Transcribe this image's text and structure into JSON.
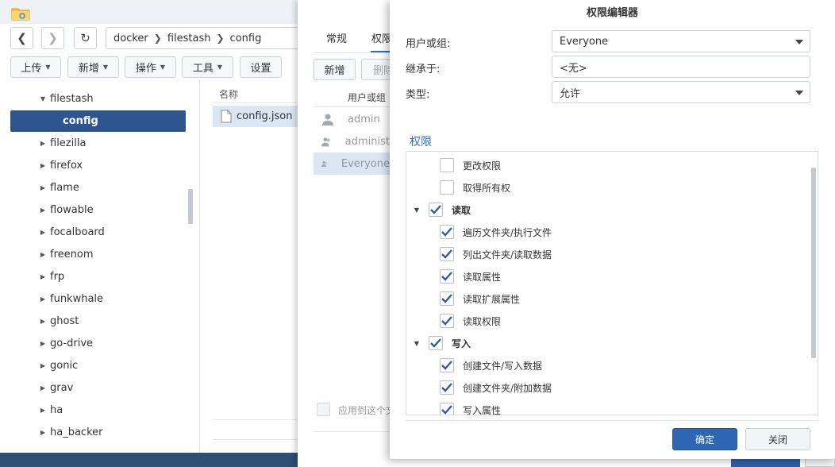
{
  "file_station": {
    "path": [
      "docker",
      "filestash",
      "config"
    ],
    "toolbar": {
      "upload": "上传",
      "create": "新增",
      "action": "操作",
      "tools": "工具",
      "settings": "设置"
    },
    "tree": {
      "parent": "filestash",
      "selected": "config",
      "items": [
        "filezilla",
        "firefox",
        "flame",
        "flowable",
        "focalboard",
        "freenom",
        "frp",
        "funkwhale",
        "ghost",
        "go-drive",
        "gonic",
        "grav",
        "ha",
        "ha_backer"
      ]
    },
    "list_header": "名称",
    "file": "config.json"
  },
  "properties": {
    "tabs": [
      "常规",
      "权限"
    ],
    "buttons": {
      "create": "新增",
      "delete": "删除"
    },
    "column_header": "用户或组",
    "rows": [
      "admin",
      "administ",
      "Everyone"
    ],
    "apply_label": "应用到这个文"
  },
  "editor": {
    "title": "权限编辑器",
    "user_label": "用户或组:",
    "user_value": "Everyone",
    "inherit_label": "继承于:",
    "inherit_value": "<无>",
    "type_label": "类型:",
    "type_value": "允许",
    "section_title": "权限",
    "perms": [
      {
        "label": "更改权限",
        "checked": false,
        "group": false
      },
      {
        "label": "取得所有权",
        "checked": false,
        "group": false
      },
      {
        "label": "读取",
        "checked": true,
        "group": true
      },
      {
        "label": "遍历文件夹/执行文件",
        "checked": true,
        "group": false
      },
      {
        "label": "列出文件夹/读取数据",
        "checked": true,
        "group": false
      },
      {
        "label": "读取属性",
        "checked": true,
        "group": false
      },
      {
        "label": "读取扩展属性",
        "checked": true,
        "group": false
      },
      {
        "label": "读取权限",
        "checked": true,
        "group": false
      },
      {
        "label": "写入",
        "checked": true,
        "group": true
      },
      {
        "label": "创建文件/写入数据",
        "checked": true,
        "group": false
      },
      {
        "label": "创建文件夹/附加数据",
        "checked": true,
        "group": false
      },
      {
        "label": "写入属性",
        "checked": true,
        "group": false
      }
    ],
    "ok": "确定",
    "close": "关闭"
  },
  "colors": {
    "accent": "#2e66b4",
    "selection": "#2e5590",
    "check": "#2e5fa5"
  }
}
